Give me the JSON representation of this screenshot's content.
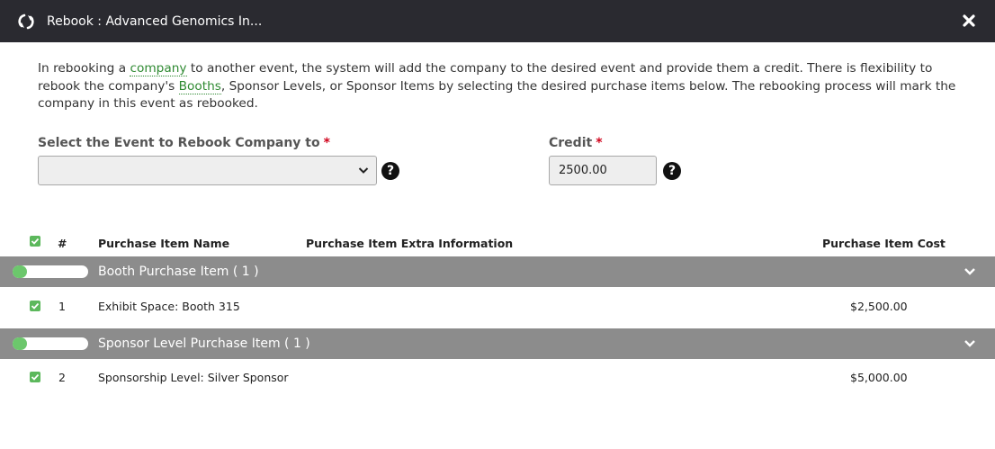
{
  "dialog": {
    "title": "Rebook : Advanced Genomics In...",
    "icons": {
      "title": "rebook-icon",
      "close": "close-icon"
    }
  },
  "intro": {
    "part1": "In rebooking a ",
    "link_company": "company",
    "part2": " to another event, the system will add the company to the desired event and provide them a credit. There is flexibility to rebook the company's ",
    "link_booths": "Booths",
    "part3": ", Sponsor Levels, or Sponsor Items by selecting the desired purchase items below. The rebooking process will mark the company in this event as rebooked."
  },
  "form": {
    "event_label": "Select the Event to Rebook Company to",
    "credit_label": "Credit",
    "required_mark": "*",
    "event_value": "",
    "credit_value": "2500.00",
    "help_glyph": "?"
  },
  "table": {
    "headers": {
      "number": "#",
      "name": "Purchase Item Name",
      "extra": "Purchase Item Extra Information",
      "cost": "Purchase Item Cost"
    },
    "select_all_checked": true,
    "groups": [
      {
        "label": "Booth Purchase Item ( 1 )",
        "items": [
          {
            "number": "1",
            "name": "Exhibit Space: Booth 315",
            "extra": "",
            "cost": "$2,500.00",
            "checked": true
          }
        ]
      },
      {
        "label": "Sponsor Level Purchase Item ( 1 )",
        "items": [
          {
            "number": "2",
            "name": "Sponsorship Level: Silver Sponsor",
            "extra": "",
            "cost": "$5,000.00",
            "checked": true
          }
        ]
      }
    ]
  },
  "colors": {
    "titlebar": "#2a2a30",
    "group_bar": "#8c8c8c",
    "accent_green": "#5cb85c",
    "link_green": "#2f8a32",
    "required_red": "#d0021b"
  }
}
